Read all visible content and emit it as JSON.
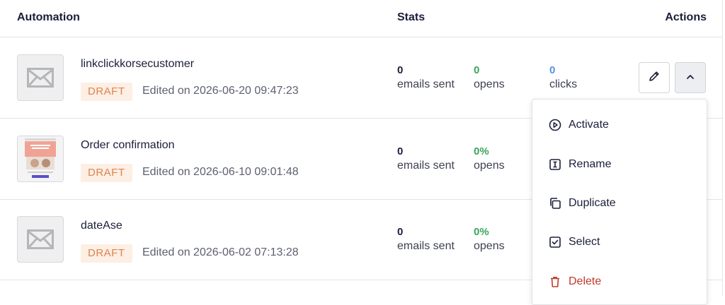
{
  "header": {
    "automation": "Automation",
    "stats": "Stats",
    "actions": "Actions"
  },
  "rows": [
    {
      "name": "linkclickkorsecustomer",
      "status": "DRAFT",
      "edited": "Edited on 2026-06-20 09:47:23",
      "thumbnail": "envelope-icon",
      "emails_sent": "0",
      "emails_sent_label": "emails sent",
      "opens": "0",
      "opens_label": "opens",
      "clicks": "0",
      "clicks_label": "clicks"
    },
    {
      "name": "Order confirmation",
      "status": "DRAFT",
      "edited": "Edited on 2026-06-10 09:01:48",
      "thumbnail": "email-preview-image",
      "emails_sent": "0",
      "emails_sent_label": "emails sent",
      "opens": "0%",
      "opens_label": "opens"
    },
    {
      "name": "dateAse",
      "status": "DRAFT",
      "edited": "Edited on 2026-06-02 07:13:28",
      "thumbnail": "envelope-icon",
      "emails_sent": "0",
      "emails_sent_label": "emails sent",
      "opens": "0%",
      "opens_label": "opens"
    }
  ],
  "menu": {
    "items": [
      {
        "label": "Activate",
        "icon": "play-circle-icon"
      },
      {
        "label": "Rename",
        "icon": "text-cursor-icon"
      },
      {
        "label": "Duplicate",
        "icon": "copy-icon"
      },
      {
        "label": "Select",
        "icon": "checkbox-icon"
      },
      {
        "label": "Delete",
        "icon": "trash-icon"
      }
    ]
  },
  "colors": {
    "draft_text": "#e0824f",
    "draft_bg": "#fdefe4",
    "opens": "#3aa55a",
    "clicks": "#5c8fe0",
    "delete": "#c0392b"
  }
}
